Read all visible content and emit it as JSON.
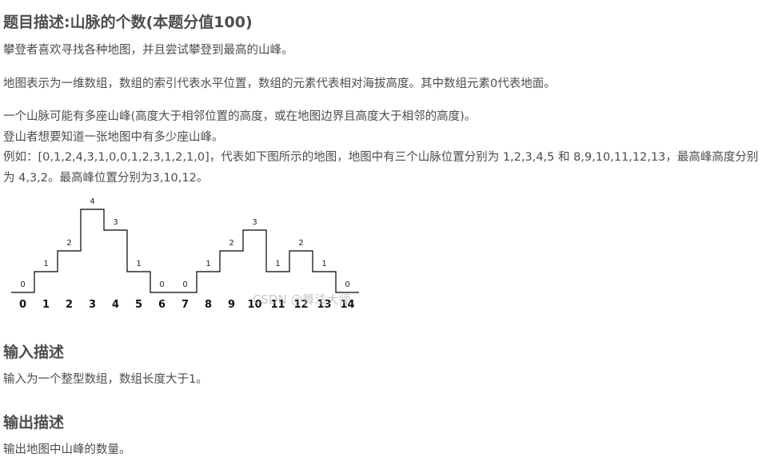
{
  "problem": {
    "title": "题目描述:山脉的个数(本题分值100)",
    "paragraphs": [
      "攀登者喜欢寻找各种地图，并且尝试攀登到最高的山峰。",
      "地图表示为一维数组，数组的索引代表水平位置，数组的元素代表相对海拔高度。其中数组元素0代表地面。",
      "一个山脉可能有多座山峰(高度大于相邻位置的高度，或在地图边界且高度大于相邻的高度)。",
      "登山者想要知道一张地图中有多少座山峰。",
      "例如：[0,1,2,4,3,1,0,0,1,2,3,1,2,1,0]，代表如下图所示的地图，地图中有三个山脉位置分别为 1,2,3,4,5 和 8,9,10,11,12,13，最高峰高度分别为 4,3,2。最高峰位置分别为3,10,12。"
    ]
  },
  "diagram": {
    "heights": [
      0,
      1,
      2,
      4,
      3,
      1,
      0,
      0,
      1,
      2,
      3,
      1,
      2,
      1,
      0
    ],
    "indices": [
      "0",
      "1",
      "2",
      "3",
      "4",
      "5",
      "6",
      "7",
      "8",
      "9",
      "10",
      "11",
      "12",
      "13",
      "14"
    ]
  },
  "watermark": "CSDN @算法大师",
  "input": {
    "heading": "输入描述",
    "text": "输入为一个整型数组，数组长度大于1。"
  },
  "output": {
    "heading": "输出描述",
    "text": "输出地图中山峰的数量。"
  }
}
